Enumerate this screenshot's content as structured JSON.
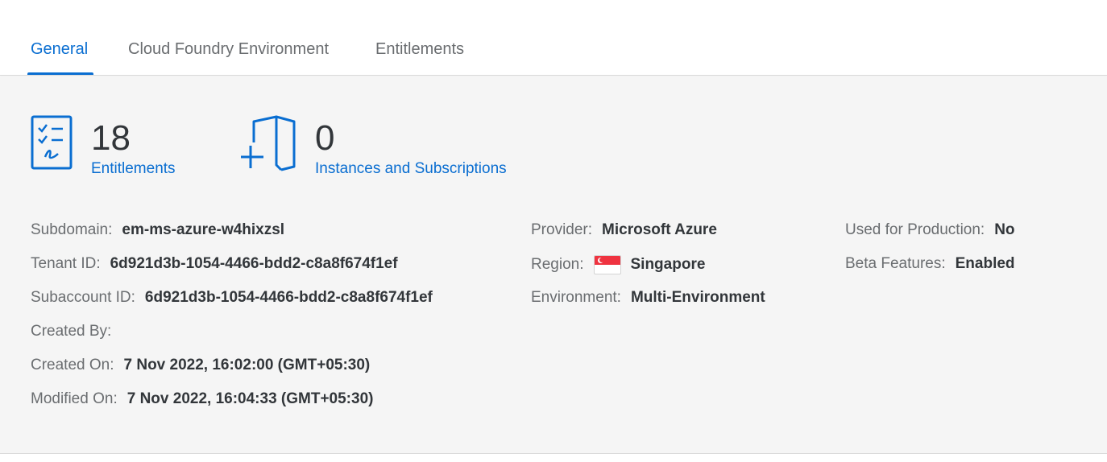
{
  "tabs": [
    {
      "label": "General",
      "active": true
    },
    {
      "label": "Cloud Foundry Environment",
      "active": false
    },
    {
      "label": "Entitlements",
      "active": false
    }
  ],
  "kpis": {
    "entitlements": {
      "count": "18",
      "label": "Entitlements",
      "icon": "checklist-icon"
    },
    "instances": {
      "count": "0",
      "label": "Instances and Subscriptions",
      "icon": "add-document-icon"
    }
  },
  "details": {
    "subdomain": {
      "label": "Subdomain:",
      "value": "em-ms-azure-w4hixzsl"
    },
    "tenant_id": {
      "label": "Tenant ID:",
      "value": "6d921d3b-1054-4466-bdd2-c8a8f674f1ef"
    },
    "subaccount_id": {
      "label": "Subaccount ID:",
      "value": "6d921d3b-1054-4466-bdd2-c8a8f674f1ef"
    },
    "created_by": {
      "label": "Created By:",
      "value": ""
    },
    "created_on": {
      "label": "Created On:",
      "value": "7 Nov 2022, 16:02:00 (GMT+05:30)"
    },
    "modified_on": {
      "label": "Modified On:",
      "value": "7 Nov 2022, 16:04:33 (GMT+05:30)"
    },
    "provider": {
      "label": "Provider:",
      "value": "Microsoft Azure"
    },
    "region": {
      "label": "Region:",
      "value": "Singapore",
      "flag_icon": "singapore-flag-icon"
    },
    "environment": {
      "label": "Environment:",
      "value": "Multi-Environment"
    },
    "used_for_production": {
      "label": "Used for Production:",
      "value": "No"
    },
    "beta_features": {
      "label": "Beta Features:",
      "value": "Enabled"
    }
  },
  "colors": {
    "accent": "#0a6ed1",
    "background": "#f5f5f5",
    "text": "#32363a",
    "label": "#6a6d70"
  }
}
